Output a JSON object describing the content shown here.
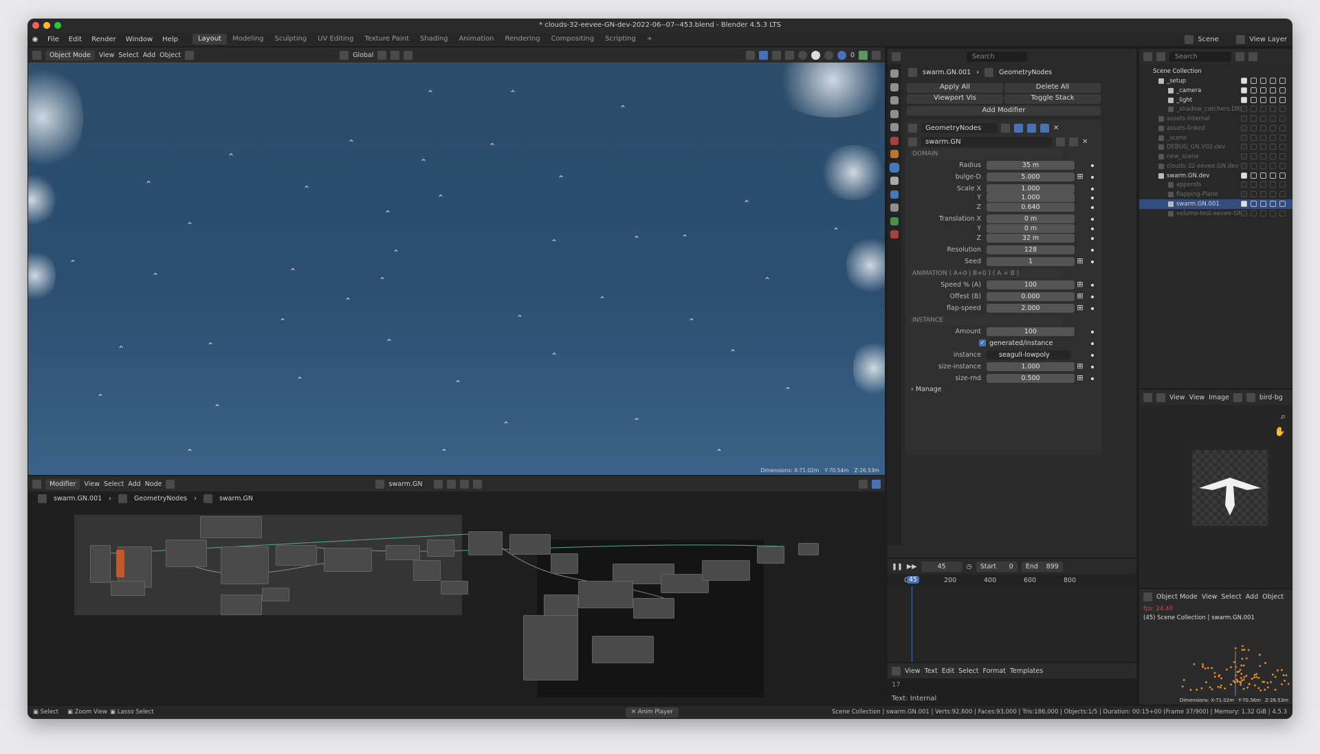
{
  "window": {
    "title": "* clouds-32-eevee-GN-dev-2022-06--07--453.blend - Blender 4.5.3 LTS"
  },
  "menu": [
    "File",
    "Edit",
    "Render",
    "Window",
    "Help"
  ],
  "workspaces": [
    "Layout",
    "Modeling",
    "Sculpting",
    "UV Editing",
    "Texture Paint",
    "Shading",
    "Animation",
    "Rendering",
    "Compositing",
    "Scripting"
  ],
  "active_workspace": "Layout",
  "viewport": {
    "mode": "Object Mode",
    "menus": [
      "View",
      "Select",
      "Add",
      "Object"
    ],
    "orientation": "Global",
    "overlay_count": "0",
    "dimensions": {
      "x": "Dimensions: X-71.02m",
      "y": "Y-70.54m",
      "z": "Z-26.53m"
    }
  },
  "top_right": {
    "search_placeholder": "Search",
    "scene": "Scene",
    "view_layer": "View Layer",
    "outliner_search": "Search"
  },
  "properties": {
    "breadcrumb": {
      "object": "swarm.GN.001",
      "modifier": "GeometryNodes"
    },
    "buttons": {
      "apply_all": "Apply All",
      "delete_all": "Delete All",
      "viewport_vis": "Viewport Vis",
      "toggle_stack": "Toggle Stack",
      "add_modifier": "Add Modifier"
    },
    "modifier_name": "GeometryNodes",
    "node_group": "swarm.GN",
    "sections": {
      "domain": "DOMAIN",
      "animation": "ANIMATION  ( A+0 | B+0 )  ( A + B )",
      "instance": "INSTANCE"
    },
    "fields": [
      {
        "label": "Radius",
        "value": "35 m",
        "key": false
      },
      {
        "label": "bulge-D",
        "value": "5.000",
        "key": true
      },
      {
        "label": "Scale X",
        "value": "1.000",
        "key": false
      },
      {
        "label": "Y",
        "value": "1.000",
        "key": false
      },
      {
        "label": "Z",
        "value": "0.640",
        "key": false
      },
      {
        "label": "Translation X",
        "value": "0 m",
        "key": false
      },
      {
        "label": "Y",
        "value": "0 m",
        "key": false
      },
      {
        "label": "Z",
        "value": "32 m",
        "key": false
      },
      {
        "label": "Resolution",
        "value": "128",
        "key": false
      },
      {
        "label": "Seed",
        "value": "1",
        "key": true
      }
    ],
    "anim_fields": [
      {
        "label": "Speed % (A)",
        "value": "100",
        "key": true
      },
      {
        "label": "Offest (B)",
        "value": "0.000",
        "key": true
      },
      {
        "label": "flap-speed",
        "value": "2.000",
        "key": true
      }
    ],
    "amount": {
      "label": "Amount",
      "value": "100"
    },
    "checkbox": {
      "label": "generated/instance",
      "checked": true
    },
    "instance": {
      "label": "instance",
      "value": "seagull-lowpoly"
    },
    "size_fields": [
      {
        "label": "size-instance",
        "value": "1.000"
      },
      {
        "label": "size-rnd",
        "value": "0.500"
      }
    ],
    "manage": "Manage"
  },
  "outliner": {
    "root": "Scene Collection",
    "items": [
      {
        "name": "_setup",
        "indent": 1,
        "dim": false
      },
      {
        "name": "_camera",
        "indent": 2,
        "dim": false
      },
      {
        "name": "_light",
        "indent": 2,
        "dim": false
      },
      {
        "name": "_shadow_catchers.DRIVI",
        "indent": 2,
        "dim": true
      },
      {
        "name": "assets-internal",
        "indent": 1,
        "dim": true
      },
      {
        "name": "assets-linked",
        "indent": 1,
        "dim": true
      },
      {
        "name": "_scene",
        "indent": 1,
        "dim": true
      },
      {
        "name": "DEBUG_GN.V02.dev",
        "indent": 1,
        "dim": true
      },
      {
        "name": "new_scene",
        "indent": 1,
        "dim": true
      },
      {
        "name": "clouds-32-eevee.GN.dev",
        "indent": 1,
        "dim": true
      },
      {
        "name": "swarm.GN.dev",
        "indent": 1,
        "dim": false
      },
      {
        "name": "appends",
        "indent": 2,
        "dim": true
      },
      {
        "name": "flapping-Plane",
        "indent": 2,
        "dim": true
      },
      {
        "name": "swarm.GN.001",
        "indent": 2,
        "dim": false,
        "selected": true
      },
      {
        "name": "volume-test-eevee-GN",
        "indent": 2,
        "dim": true
      }
    ]
  },
  "image_editor": {
    "menus": [
      "View",
      "View",
      "Image"
    ],
    "image_name": "bird-bg"
  },
  "timeline": {
    "current_frame": "45",
    "start_label": "Start",
    "start": "0",
    "end_label": "End",
    "end": "899",
    "ticks": [
      "0",
      "200",
      "400",
      "600",
      "800"
    ],
    "playhead": "45"
  },
  "text_editor": {
    "menus": [
      "View",
      "Text",
      "Edit",
      "Select",
      "Format",
      "Templates"
    ],
    "line_number": "17",
    "footer": "Text: Internal"
  },
  "node_editor": {
    "type": "Modifier",
    "menus": [
      "View",
      "Select",
      "Add",
      "Node"
    ],
    "group": "swarm.GN",
    "breadcrumb": [
      "swarm.GN.001",
      "GeometryNodes",
      "swarm.GN"
    ]
  },
  "mini_viewport": {
    "mode": "Object Mode",
    "menus": [
      "View",
      "Select",
      "Add",
      "Object"
    ],
    "fps": "fps: 24.40",
    "label": "(45) Scene Collection | swarm.GN.001",
    "dimensions": {
      "x": "Dimensions: X-71.02m",
      "y": "Y-70.56m",
      "z": "Z-26.53m"
    }
  },
  "status": {
    "left": [
      "Select",
      "Zoom View",
      "Lasso Select"
    ],
    "center": "Anim Player",
    "right": "Scene Collection | swarm.GN.001 | Verts:92,600 | Faces:93,000 | Tris:186,000 | Objects:1/5 | Duration: 00:15+00 (Frame 37/900) | Memory: 1.32 GiB | 4.5.3"
  },
  "colors": {
    "accent": "#4772b3",
    "sky": "#2d4d6b",
    "panel": "#2a2a2a"
  }
}
